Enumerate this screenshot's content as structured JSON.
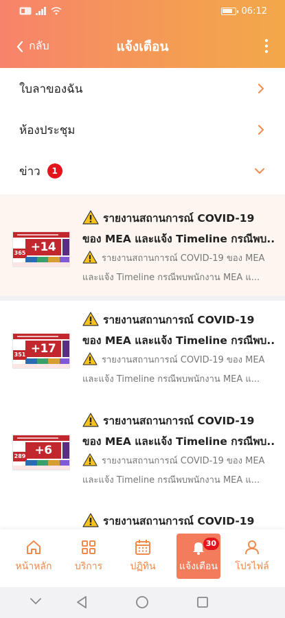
{
  "status_bar": {
    "time": "06:12",
    "battery_level": 0.8
  },
  "app_bar": {
    "back_label": "กลับ",
    "title": "แจ้งเตือน"
  },
  "menu": {
    "items": [
      {
        "label": "ใบลาของฉัน"
      },
      {
        "label": "ห้องประชุม"
      },
      {
        "label": "ข่าว",
        "badge": "1"
      }
    ]
  },
  "news": [
    {
      "title_line1": "รายงานสถานการณ์ COVID-19",
      "title_line2": "ของ MEA และแจ้ง Timeline กรณีพบ...",
      "desc_line1": "รายงานสถานการณ์ COVID-19 ของ MEA",
      "desc_line2": "และแจ้ง Timeline กรณีพบพนักงาน MEA แ...",
      "thumb_count": "+14",
      "thumb_total": "365",
      "highlighted": true
    },
    {
      "title_line1": "รายงานสถานการณ์ COVID-19",
      "title_line2": "ของ MEA และแจ้ง Timeline กรณีพบ...",
      "desc_line1": "รายงานสถานการณ์ COVID-19 ของ MEA",
      "desc_line2": "และแจ้ง Timeline กรณีพบพนักงาน MEA แ...",
      "thumb_count": "+17",
      "thumb_total": "351",
      "highlighted": false
    },
    {
      "title_line1": "รายงานสถานการณ์ COVID-19",
      "title_line2": "ของ MEA และแจ้ง Timeline กรณีพบ...",
      "desc_line1": "รายงานสถานการณ์ COVID-19 ของ MEA",
      "desc_line2": "และแจ้ง Timeline กรณีพบพนักงาน MEA แ...",
      "thumb_count": "+6",
      "thumb_total": "289",
      "highlighted": false
    },
    {
      "title_line1": "รายงานสถานการณ์ COVID-19",
      "title_line2": "",
      "desc_line1": "",
      "desc_line2": "",
      "thumb_count": "",
      "thumb_total": "",
      "highlighted": false
    }
  ],
  "bottom_nav": {
    "items": [
      {
        "label": "หน้าหลัก",
        "icon": "home-icon"
      },
      {
        "label": "บริการ",
        "icon": "grid-icon"
      },
      {
        "label": "ปฏิทิน",
        "icon": "calendar-icon"
      },
      {
        "label": "แจ้งเตือน",
        "icon": "bell-icon",
        "badge": "30",
        "active": true
      },
      {
        "label": "โปรไฟล์",
        "icon": "user-icon"
      }
    ]
  },
  "colors": {
    "accent": "#f0894a",
    "header_start": "#f7836b",
    "header_end": "#f3a849",
    "badge_red": "#e5141c",
    "active_tab": "#f27c5c"
  }
}
